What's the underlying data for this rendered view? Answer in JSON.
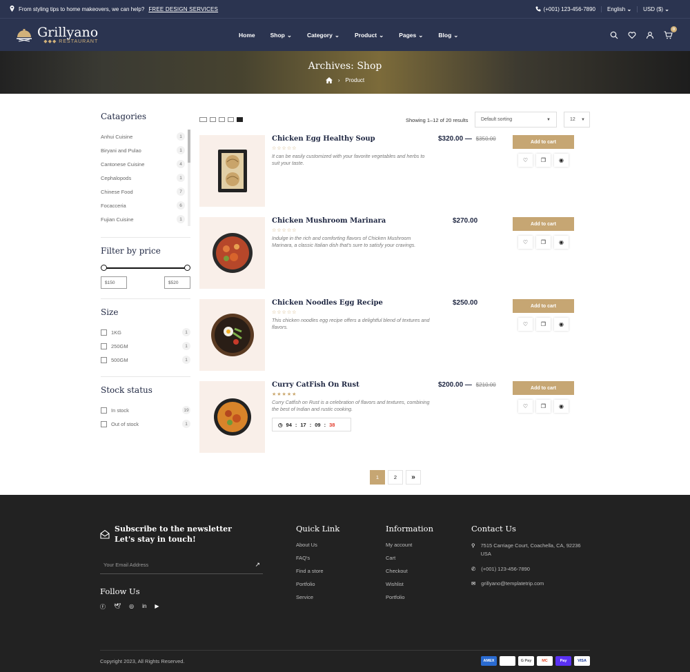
{
  "topbar": {
    "promo_text": "From styling tips to home makeovers, we can help?",
    "promo_link": "FREE DESIGN SERVICES",
    "phone": "(+001) 123-456-7890",
    "language": "English",
    "currency": "USD ($)"
  },
  "header": {
    "logo_name": "Grillyano",
    "logo_sub": "RESTAURANT",
    "nav": [
      "Home",
      "Shop",
      "Category",
      "Product",
      "Pages",
      "Blog"
    ],
    "cart_count": "0"
  },
  "banner": {
    "title": "Archives: Shop",
    "breadcrumb_current": "Product"
  },
  "sidebar": {
    "categories_title": "Catagories",
    "categories": [
      {
        "name": "Anhui Cuisine",
        "count": "1"
      },
      {
        "name": "Biryani and Pulao",
        "count": "1"
      },
      {
        "name": "Cantonese Cuisine",
        "count": "4"
      },
      {
        "name": "Cephalopods",
        "count": "1"
      },
      {
        "name": "Chinese Food",
        "count": "7"
      },
      {
        "name": "Focacceria",
        "count": "6"
      },
      {
        "name": "Fujian Cuisine",
        "count": "1"
      }
    ],
    "price_title": "Filter by price",
    "price_min": "$150",
    "price_max": "$520",
    "size_title": "Size",
    "sizes": [
      {
        "name": "1KG",
        "count": "1"
      },
      {
        "name": "250GM",
        "count": "1"
      },
      {
        "name": "500GM",
        "count": "1"
      }
    ],
    "stock_title": "Stock status",
    "stock": [
      {
        "name": "In stock",
        "count": "19"
      },
      {
        "name": "Out of stock",
        "count": "1"
      }
    ]
  },
  "toolbar": {
    "results": "Showing 1–12 of 20 results",
    "sorting": "Default sorting",
    "per_page": "12"
  },
  "products": [
    {
      "name": "Chicken Egg Healthy Soup",
      "price": "$320.00",
      "old_price": "$350.00",
      "stars": "☆☆☆☆☆",
      "desc": "It can be easily customized with your favorite vegetables and herbs to suit your taste.",
      "cart": "Add to cart"
    },
    {
      "name": "Chicken Mushroom Marinara",
      "price": "$270.00",
      "old_price": "",
      "stars": "☆☆☆☆☆",
      "desc": "Indulge in the rich and comforting flavors of Chicken Mushroom Marinara, a classic Italian dish that's sure to satisfy your cravings.",
      "cart": "Add to cart"
    },
    {
      "name": "Chicken Noodles Egg Recipe",
      "price": "$250.00",
      "old_price": "",
      "stars": "☆☆☆☆☆",
      "desc": "This chicken noodles egg recipe offers a delightful blend of textures and flavors.",
      "cart": "Add to cart"
    },
    {
      "name": "Curry CatFish On Rust",
      "price": "$200.00",
      "old_price": "$210.00",
      "stars": "★★★★★",
      "desc": "Curry Catfish on Rust is a celebration of flavors and textures, combining the best of Indian and rustic cooking.",
      "cart": "Add to cart"
    }
  ],
  "timer": {
    "days": "94",
    "hours": "17",
    "minutes": "09",
    "seconds": "38"
  },
  "pagination": {
    "page1": "1",
    "page2": "2",
    "next": "»"
  },
  "footer": {
    "subscribe_title": "Subscribe to the newsletter Let's stay in touch!",
    "email_placeholder": "Your Email Address",
    "follow_title": "Follow Us",
    "quick_title": "Quick Link",
    "quick_links": [
      "About Us",
      "FAQ's",
      "Find a store",
      "Portfolio",
      "Service"
    ],
    "info_title": "Information",
    "info_links": [
      "My account",
      "Cart",
      "Checkout",
      "Wishlist",
      "Portfolio"
    ],
    "contact_title": "Contact Us",
    "address": "7515 Carriage Court, Coachella, CA, 92236 USA",
    "phone": "(+001) 123-456-7890",
    "email": "grillyano@templatetrip.com",
    "copyright": "Copyright 2023, All Rights Reserved.",
    "payments": [
      "AMEX",
      "Pay",
      "G Pay",
      "MC",
      "Pay",
      "VISA"
    ]
  }
}
